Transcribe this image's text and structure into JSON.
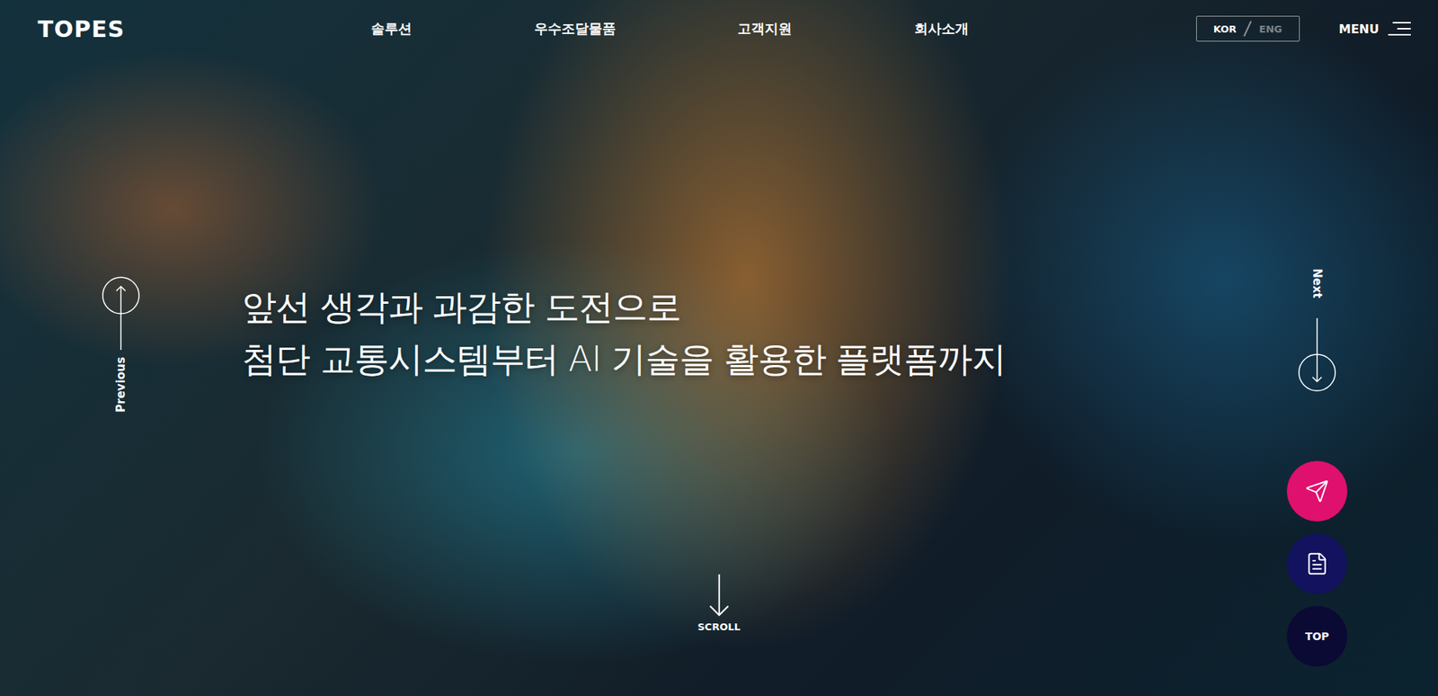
{
  "header": {
    "logo": "TOPES",
    "nav": [
      {
        "label": "솔루션"
      },
      {
        "label": "우수조달물품"
      },
      {
        "label": "고객지원"
      },
      {
        "label": "회사소개"
      }
    ],
    "languages": [
      {
        "label": "KOR",
        "selected": true
      },
      {
        "label": "ENG",
        "selected": false
      }
    ],
    "menu": "MENU"
  },
  "hero": {
    "headline": [
      "앞선 생각과 과감한 도전으로",
      "첨단 교통시스템부터 AI 기술을 활용한 플랫폼까지"
    ],
    "previous": "Previous",
    "next": "Next",
    "scroll": "SCROLL"
  },
  "floating": [
    {
      "kind": "send",
      "color": "#e0106f"
    },
    {
      "kind": "guide",
      "color": "#12125e"
    },
    {
      "kind": "top",
      "label": "TOP",
      "color": "#0a0a35"
    }
  ]
}
